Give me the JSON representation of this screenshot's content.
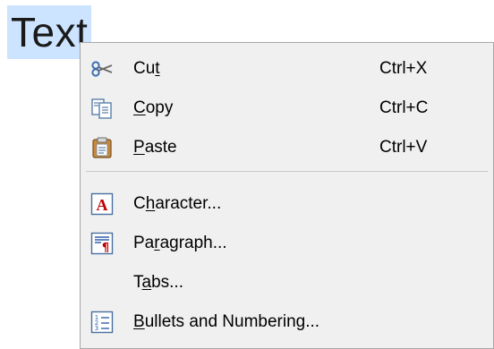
{
  "document": {
    "text": "Text"
  },
  "menu": {
    "items": [
      {
        "id": "cut",
        "icon": "scissors-icon",
        "pre": "Cu",
        "ul": "t",
        "post": "",
        "shortcut": "Ctrl+X"
      },
      {
        "id": "copy",
        "icon": "copy-icon",
        "pre": "",
        "ul": "C",
        "post": "opy",
        "shortcut": "Ctrl+C"
      },
      {
        "id": "paste",
        "icon": "clipboard-icon",
        "pre": "",
        "ul": "P",
        "post": "aste",
        "shortcut": "Ctrl+V"
      },
      {
        "id": "character",
        "icon": "character-icon",
        "pre": "C",
        "ul": "h",
        "post": "aracter...",
        "shortcut": ""
      },
      {
        "id": "paragraph",
        "icon": "paragraph-icon",
        "pre": "Pa",
        "ul": "r",
        "post": "agraph...",
        "shortcut": ""
      },
      {
        "id": "tabs",
        "icon": "",
        "pre": "T",
        "ul": "a",
        "post": "bs...",
        "shortcut": ""
      },
      {
        "id": "bullets",
        "icon": "bullets-numbering-icon",
        "pre": "",
        "ul": "B",
        "post": "ullets and Numbering...",
        "shortcut": ""
      }
    ]
  },
  "colors": {
    "selection": "#cce4ff",
    "menu_background": "#f0f0f0",
    "character_icon": "#c00000",
    "paragraph_icon": "#2f5fa8"
  }
}
